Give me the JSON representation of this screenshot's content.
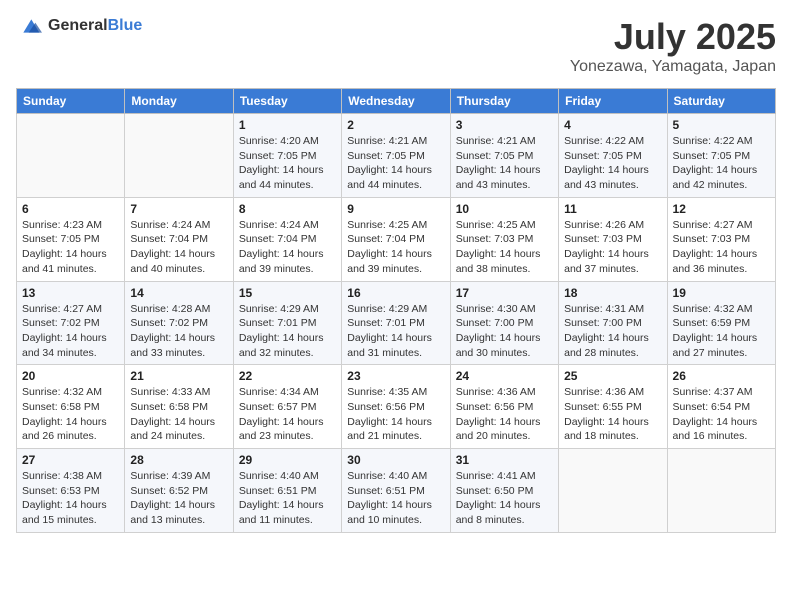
{
  "logo": {
    "text_general": "General",
    "text_blue": "Blue"
  },
  "header": {
    "month": "July 2025",
    "location": "Yonezawa, Yamagata, Japan"
  },
  "days_of_week": [
    "Sunday",
    "Monday",
    "Tuesday",
    "Wednesday",
    "Thursday",
    "Friday",
    "Saturday"
  ],
  "weeks": [
    [
      {
        "day": "",
        "sunrise": "",
        "sunset": "",
        "daylight": ""
      },
      {
        "day": "",
        "sunrise": "",
        "sunset": "",
        "daylight": ""
      },
      {
        "day": "1",
        "sunrise": "Sunrise: 4:20 AM",
        "sunset": "Sunset: 7:05 PM",
        "daylight": "Daylight: 14 hours and 44 minutes."
      },
      {
        "day": "2",
        "sunrise": "Sunrise: 4:21 AM",
        "sunset": "Sunset: 7:05 PM",
        "daylight": "Daylight: 14 hours and 44 minutes."
      },
      {
        "day": "3",
        "sunrise": "Sunrise: 4:21 AM",
        "sunset": "Sunset: 7:05 PM",
        "daylight": "Daylight: 14 hours and 43 minutes."
      },
      {
        "day": "4",
        "sunrise": "Sunrise: 4:22 AM",
        "sunset": "Sunset: 7:05 PM",
        "daylight": "Daylight: 14 hours and 43 minutes."
      },
      {
        "day": "5",
        "sunrise": "Sunrise: 4:22 AM",
        "sunset": "Sunset: 7:05 PM",
        "daylight": "Daylight: 14 hours and 42 minutes."
      }
    ],
    [
      {
        "day": "6",
        "sunrise": "Sunrise: 4:23 AM",
        "sunset": "Sunset: 7:05 PM",
        "daylight": "Daylight: 14 hours and 41 minutes."
      },
      {
        "day": "7",
        "sunrise": "Sunrise: 4:24 AM",
        "sunset": "Sunset: 7:04 PM",
        "daylight": "Daylight: 14 hours and 40 minutes."
      },
      {
        "day": "8",
        "sunrise": "Sunrise: 4:24 AM",
        "sunset": "Sunset: 7:04 PM",
        "daylight": "Daylight: 14 hours and 39 minutes."
      },
      {
        "day": "9",
        "sunrise": "Sunrise: 4:25 AM",
        "sunset": "Sunset: 7:04 PM",
        "daylight": "Daylight: 14 hours and 39 minutes."
      },
      {
        "day": "10",
        "sunrise": "Sunrise: 4:25 AM",
        "sunset": "Sunset: 7:03 PM",
        "daylight": "Daylight: 14 hours and 38 minutes."
      },
      {
        "day": "11",
        "sunrise": "Sunrise: 4:26 AM",
        "sunset": "Sunset: 7:03 PM",
        "daylight": "Daylight: 14 hours and 37 minutes."
      },
      {
        "day": "12",
        "sunrise": "Sunrise: 4:27 AM",
        "sunset": "Sunset: 7:03 PM",
        "daylight": "Daylight: 14 hours and 36 minutes."
      }
    ],
    [
      {
        "day": "13",
        "sunrise": "Sunrise: 4:27 AM",
        "sunset": "Sunset: 7:02 PM",
        "daylight": "Daylight: 14 hours and 34 minutes."
      },
      {
        "day": "14",
        "sunrise": "Sunrise: 4:28 AM",
        "sunset": "Sunset: 7:02 PM",
        "daylight": "Daylight: 14 hours and 33 minutes."
      },
      {
        "day": "15",
        "sunrise": "Sunrise: 4:29 AM",
        "sunset": "Sunset: 7:01 PM",
        "daylight": "Daylight: 14 hours and 32 minutes."
      },
      {
        "day": "16",
        "sunrise": "Sunrise: 4:29 AM",
        "sunset": "Sunset: 7:01 PM",
        "daylight": "Daylight: 14 hours and 31 minutes."
      },
      {
        "day": "17",
        "sunrise": "Sunrise: 4:30 AM",
        "sunset": "Sunset: 7:00 PM",
        "daylight": "Daylight: 14 hours and 30 minutes."
      },
      {
        "day": "18",
        "sunrise": "Sunrise: 4:31 AM",
        "sunset": "Sunset: 7:00 PM",
        "daylight": "Daylight: 14 hours and 28 minutes."
      },
      {
        "day": "19",
        "sunrise": "Sunrise: 4:32 AM",
        "sunset": "Sunset: 6:59 PM",
        "daylight": "Daylight: 14 hours and 27 minutes."
      }
    ],
    [
      {
        "day": "20",
        "sunrise": "Sunrise: 4:32 AM",
        "sunset": "Sunset: 6:58 PM",
        "daylight": "Daylight: 14 hours and 26 minutes."
      },
      {
        "day": "21",
        "sunrise": "Sunrise: 4:33 AM",
        "sunset": "Sunset: 6:58 PM",
        "daylight": "Daylight: 14 hours and 24 minutes."
      },
      {
        "day": "22",
        "sunrise": "Sunrise: 4:34 AM",
        "sunset": "Sunset: 6:57 PM",
        "daylight": "Daylight: 14 hours and 23 minutes."
      },
      {
        "day": "23",
        "sunrise": "Sunrise: 4:35 AM",
        "sunset": "Sunset: 6:56 PM",
        "daylight": "Daylight: 14 hours and 21 minutes."
      },
      {
        "day": "24",
        "sunrise": "Sunrise: 4:36 AM",
        "sunset": "Sunset: 6:56 PM",
        "daylight": "Daylight: 14 hours and 20 minutes."
      },
      {
        "day": "25",
        "sunrise": "Sunrise: 4:36 AM",
        "sunset": "Sunset: 6:55 PM",
        "daylight": "Daylight: 14 hours and 18 minutes."
      },
      {
        "day": "26",
        "sunrise": "Sunrise: 4:37 AM",
        "sunset": "Sunset: 6:54 PM",
        "daylight": "Daylight: 14 hours and 16 minutes."
      }
    ],
    [
      {
        "day": "27",
        "sunrise": "Sunrise: 4:38 AM",
        "sunset": "Sunset: 6:53 PM",
        "daylight": "Daylight: 14 hours and 15 minutes."
      },
      {
        "day": "28",
        "sunrise": "Sunrise: 4:39 AM",
        "sunset": "Sunset: 6:52 PM",
        "daylight": "Daylight: 14 hours and 13 minutes."
      },
      {
        "day": "29",
        "sunrise": "Sunrise: 4:40 AM",
        "sunset": "Sunset: 6:51 PM",
        "daylight": "Daylight: 14 hours and 11 minutes."
      },
      {
        "day": "30",
        "sunrise": "Sunrise: 4:40 AM",
        "sunset": "Sunset: 6:51 PM",
        "daylight": "Daylight: 14 hours and 10 minutes."
      },
      {
        "day": "31",
        "sunrise": "Sunrise: 4:41 AM",
        "sunset": "Sunset: 6:50 PM",
        "daylight": "Daylight: 14 hours and 8 minutes."
      },
      {
        "day": "",
        "sunrise": "",
        "sunset": "",
        "daylight": ""
      },
      {
        "day": "",
        "sunrise": "",
        "sunset": "",
        "daylight": ""
      }
    ]
  ]
}
